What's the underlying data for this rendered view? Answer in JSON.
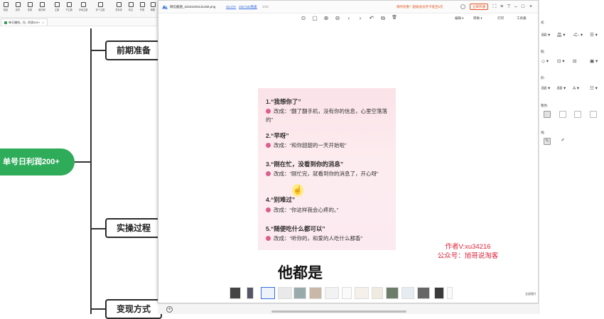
{
  "mindmap": {
    "toolbar": [
      {
        "label": "粘贴",
        "icon": "paste-icon"
      },
      {
        "label": "剪切",
        "icon": "cut-icon"
      },
      {
        "label": "复制",
        "icon": "copy-icon"
      },
      {
        "label": "格式刷",
        "icon": "format-brush-icon"
      },
      {
        "label": "主题",
        "icon": "topic-icon"
      },
      {
        "label": "子主题",
        "icon": "subtopic-icon"
      },
      {
        "label": "浮动主题",
        "icon": "floating-topic-icon"
      },
      {
        "label": "多个主题",
        "icon": "multi-topic-icon"
      },
      {
        "label": "关系线",
        "icon": "relation-line-icon"
      },
      {
        "label": "标注",
        "icon": "callout-icon"
      },
      {
        "label": "外框",
        "icon": "boundary-icon"
      },
      {
        "label": "概要",
        "icon": "summary-icon"
      }
    ],
    "tab_label": "单天赚钱，拉...利润200+",
    "tab_close": "×",
    "root_node": "单号日利润200+",
    "branches": [
      "前期准备",
      "实操过程",
      "变现方式"
    ]
  },
  "viewer": {
    "filename": "微信截图_20231003131458.png",
    "zoom": "46.27K",
    "dimensions": "282*330像素",
    "count": "3/39",
    "promo": "限时优惠！超级会员月卡低至6元",
    "vip_button": "立即开通",
    "window_controls": [
      "⛶",
      "≡",
      "⊤",
      "–",
      "□",
      "×"
    ],
    "toolbar_tools": [
      {
        "glyph": "⊙",
        "icon": "actual-size-icon"
      },
      {
        "glyph": "▢",
        "icon": "fit-window-icon"
      },
      {
        "glyph": "⊕",
        "icon": "zoom-in-icon"
      },
      {
        "glyph": "⊖",
        "icon": "zoom-out-icon"
      },
      {
        "glyph": "‹",
        "icon": "previous-icon"
      },
      {
        "glyph": "›",
        "icon": "next-icon"
      },
      {
        "glyph": "↶",
        "icon": "rotate-icon"
      },
      {
        "glyph": "⧉",
        "icon": "share-icon"
      },
      {
        "glyph": "🗑",
        "icon": "delete-icon"
      }
    ],
    "right_tools": [
      "编辑 ▾",
      "转换 ▾",
      "打印",
      "工具箱"
    ],
    "image_items": [
      {
        "title": "1.“我想你了”",
        "body": "改成：“翻了翻手机，没有你的信息，心里空落落的”"
      },
      {
        "title": "2.“早呀”",
        "body": "改成：“和你甜甜的一天开始啦”"
      },
      {
        "title": "3.“刚在忙，没看到你的消息”",
        "body": "改成：“刚忙完，就看到你的消息了，开心呀”"
      },
      {
        "title": "4.“别难过”",
        "body": "改成：“你这样我会心疼的。”"
      },
      {
        "title": "5.“随便吃什么都可以”",
        "body": "改成：“听你的，和爱的人吃什么都香”"
      }
    ],
    "watermark_line1": "作者V:xu34216",
    "watermark_line2": "公众号：旭哥说淘客",
    "subtitle": "他都是",
    "thumbnails_count": 16,
    "all_images_label": "全部图片"
  },
  "right_panel": {
    "title": "式",
    "section_labels": [
      "框:",
      "形:",
      "粗色:",
      "线:"
    ],
    "rows": [
      [
        "88 ▾",
        "品 ▾",
        "-C- ▾",
        "☰ ▾"
      ],
      [
        "◇ ▾",
        "⊡ ▾",
        "⊟",
        "▣ ▾"
      ],
      [
        "88 ▾",
        "88 ▾",
        "A ▾",
        "☷ ▾"
      ]
    ]
  },
  "colors": {
    "root_green": "#2eac5a",
    "accent_blue": "#3a6ee0",
    "promo_orange": "#e0531f",
    "watermark_red": "#e0243a",
    "bullet_pink": "#dc5e8c"
  }
}
